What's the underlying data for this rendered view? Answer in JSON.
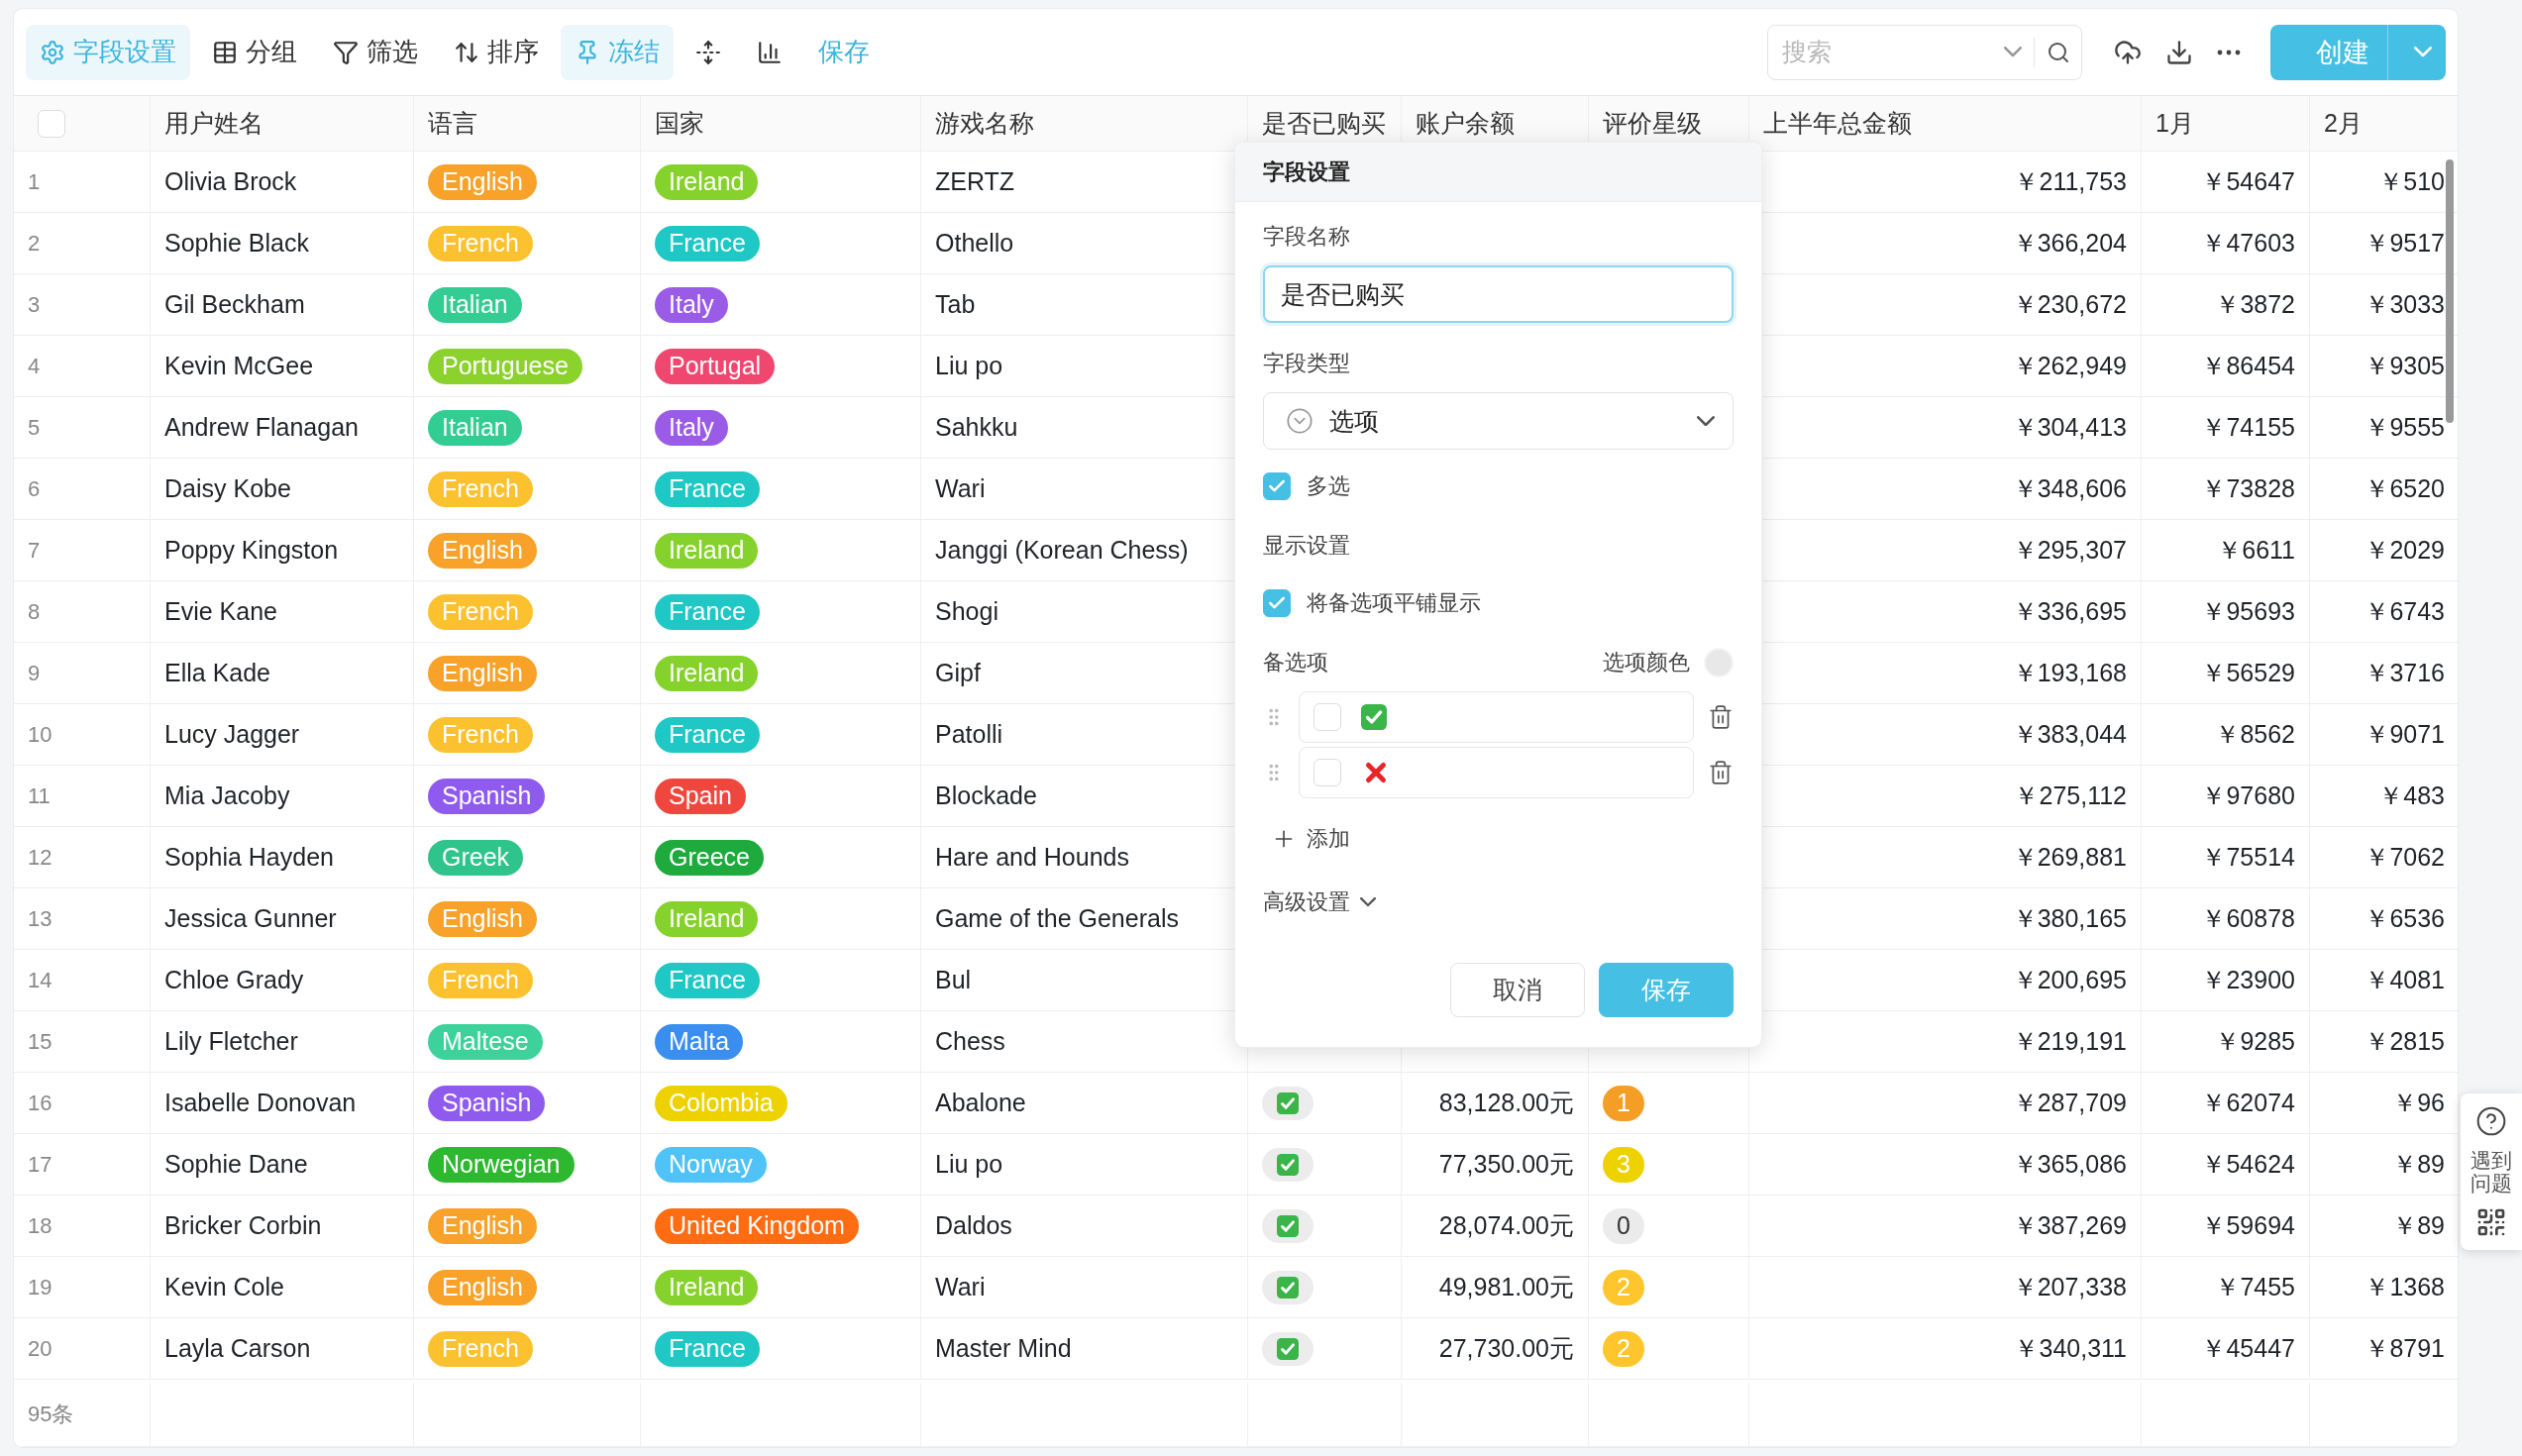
{
  "toolbar": {
    "buttons": [
      {
        "label": "字段设置",
        "selected": true
      },
      {
        "label": "分组",
        "selected": false
      },
      {
        "label": "筛选",
        "selected": false
      },
      {
        "label": "排序",
        "selected": false
      },
      {
        "label": "冻结",
        "selected": true
      },
      {
        "selected": false
      },
      {
        "selected": false
      }
    ],
    "save_link": "保存",
    "search": {
      "placeholder": "搜索"
    },
    "create_button": "创建"
  },
  "table": {
    "select_all": {
      "checked": false
    },
    "columns": [
      "用户姓名",
      "语言",
      "国家",
      "游戏名称",
      "是否已购买",
      "账户余额",
      "评价星级",
      "上半年总金额",
      "1月",
      "2月"
    ],
    "rows": [
      {
        "index": "1",
        "name": "Olivia Brock",
        "language": {
          "label": "English",
          "color": "#f8a229"
        },
        "country": {
          "label": "Ireland",
          "color": "#86d22c"
        },
        "game": "ZERTZ",
        "h1_total": "￥211,753",
        "jan": "￥54647",
        "feb": "￥510"
      },
      {
        "index": "2",
        "name": "Sophie Black",
        "language": {
          "label": "French",
          "color": "#fcc12f"
        },
        "country": {
          "label": "France",
          "color": "#1fc8c4"
        },
        "game": "Othello",
        "h1_total": "￥366,204",
        "jan": "￥47603",
        "feb": "￥9517"
      },
      {
        "index": "3",
        "name": "Gil Beckham",
        "language": {
          "label": "Italian",
          "color": "#33cc93"
        },
        "country": {
          "label": "Italy",
          "color": "#9a5ce6"
        },
        "game": "Tab",
        "h1_total": "￥230,672",
        "jan": "￥3872",
        "feb": "￥3033"
      },
      {
        "index": "4",
        "name": "Kevin McGee",
        "language": {
          "label": "Portuguese",
          "color": "#8bd22d"
        },
        "country": {
          "label": "Portugal",
          "color": "#ef4770"
        },
        "game": "Liu po",
        "h1_total": "￥262,949",
        "jan": "￥86454",
        "feb": "￥9305"
      },
      {
        "index": "5",
        "name": "Andrew Flanagan",
        "language": {
          "label": "Italian",
          "color": "#33cc93"
        },
        "country": {
          "label": "Italy",
          "color": "#9a5ce6"
        },
        "game": "Sahkku",
        "h1_total": "￥304,413",
        "jan": "￥74155",
        "feb": "￥9555"
      },
      {
        "index": "6",
        "name": "Daisy Kobe",
        "language": {
          "label": "French",
          "color": "#fcc12f"
        },
        "country": {
          "label": "France",
          "color": "#1fc8c4"
        },
        "game": "Wari",
        "h1_total": "￥348,606",
        "jan": "￥73828",
        "feb": "￥6520"
      },
      {
        "index": "7",
        "name": "Poppy Kingston",
        "language": {
          "label": "English",
          "color": "#f8a229"
        },
        "country": {
          "label": "Ireland",
          "color": "#86d22c"
        },
        "game": "Janggi (Korean Chess)",
        "h1_total": "￥295,307",
        "jan": "￥6611",
        "feb": "￥2029"
      },
      {
        "index": "8",
        "name": "Evie Kane",
        "language": {
          "label": "French",
          "color": "#fcc12f"
        },
        "country": {
          "label": "France",
          "color": "#1fc8c4"
        },
        "game": "Shogi",
        "h1_total": "￥336,695",
        "jan": "￥95693",
        "feb": "￥6743"
      },
      {
        "index": "9",
        "name": "Ella Kade",
        "language": {
          "label": "English",
          "color": "#f8a229"
        },
        "country": {
          "label": "Ireland",
          "color": "#86d22c"
        },
        "game": "Gipf",
        "h1_total": "￥193,168",
        "jan": "￥56529",
        "feb": "￥3716"
      },
      {
        "index": "10",
        "name": "Lucy Jagger",
        "language": {
          "label": "French",
          "color": "#fcc12f"
        },
        "country": {
          "label": "France",
          "color": "#1fc8c4"
        },
        "game": "Patolli",
        "h1_total": "￥383,044",
        "jan": "￥8562",
        "feb": "￥9071"
      },
      {
        "index": "11",
        "name": "Mia Jacoby",
        "language": {
          "label": "Spanish",
          "color": "#8f5bef"
        },
        "country": {
          "label": "Spain",
          "color": "#ef463d"
        },
        "game": "Blockade",
        "h1_total": "￥275,112",
        "jan": "￥97680",
        "feb": "￥483"
      },
      {
        "index": "12",
        "name": "Sophia Hayden",
        "language": {
          "label": "Greek",
          "color": "#2fc48c"
        },
        "country": {
          "label": "Greece",
          "color": "#1eaa3c"
        },
        "game": "Hare and Hounds",
        "h1_total": "￥269,881",
        "jan": "￥75514",
        "feb": "￥7062"
      },
      {
        "index": "13",
        "name": "Jessica Gunner",
        "language": {
          "label": "English",
          "color": "#f8a229"
        },
        "country": {
          "label": "Ireland",
          "color": "#86d22c"
        },
        "game": "Game of the Generals",
        "h1_total": "￥380,165",
        "jan": "￥60878",
        "feb": "￥6536"
      },
      {
        "index": "14",
        "name": "Chloe Grady",
        "language": {
          "label": "French",
          "color": "#fcc12f"
        },
        "country": {
          "label": "France",
          "color": "#1fc8c4"
        },
        "game": "Bul",
        "h1_total": "￥200,695",
        "jan": "￥23900",
        "feb": "￥4081"
      },
      {
        "index": "15",
        "name": "Lily Fletcher",
        "language": {
          "label": "Maltese",
          "color": "#3dd29c"
        },
        "country": {
          "label": "Malta",
          "color": "#3a8ef0"
        },
        "game": "Chess",
        "h1_total": "￥219,191",
        "jan": "￥9285",
        "feb": "￥2815"
      },
      {
        "index": "16",
        "name": "Isabelle Donovan",
        "language": {
          "label": "Spanish",
          "color": "#8f5bef"
        },
        "country": {
          "label": "Colombia",
          "color": "#eed200"
        },
        "game": "Abalone",
        "purchased": true,
        "balance": "83,128.00元",
        "rating": {
          "label": "1",
          "color": "#f59e26"
        },
        "h1_total": "￥287,709",
        "jan": "￥62074",
        "feb": "￥96"
      },
      {
        "index": "17",
        "name": "Sophie Dane",
        "language": {
          "label": "Norwegian",
          "color": "#2db82f"
        },
        "country": {
          "label": "Norway",
          "color": "#4fc3f7"
        },
        "game": "Liu po",
        "purchased": true,
        "balance": "77,350.00元",
        "rating": {
          "label": "3",
          "color": "#eed200"
        },
        "h1_total": "￥365,086",
        "jan": "￥54624",
        "feb": "￥89"
      },
      {
        "index": "18",
        "name": "Bricker Corbin",
        "language": {
          "label": "English",
          "color": "#f8a229"
        },
        "country": {
          "label": "United Kingdom",
          "color": "#ff6c12"
        },
        "game": "Daldos",
        "purchased": true,
        "balance": "28,074.00元",
        "rating": {
          "label": "0",
          "color": "#ebebeb"
        },
        "h1_total": "￥387,269",
        "jan": "￥59694",
        "feb": "￥89"
      },
      {
        "index": "19",
        "name": "Kevin Cole",
        "language": {
          "label": "English",
          "color": "#f8a229"
        },
        "country": {
          "label": "Ireland",
          "color": "#86d22c"
        },
        "game": "Wari",
        "purchased": true,
        "balance": "49,981.00元",
        "rating": {
          "label": "2",
          "color": "#fec62c"
        },
        "h1_total": "￥207,338",
        "jan": "￥7455",
        "feb": "￥1368"
      },
      {
        "index": "20",
        "name": "Layla Carson",
        "language": {
          "label": "French",
          "color": "#fcc12f"
        },
        "country": {
          "label": "France",
          "color": "#1fc8c4"
        },
        "game": "Master Mind",
        "purchased": true,
        "balance": "27,730.00元",
        "rating": {
          "label": "2",
          "color": "#fec62c"
        },
        "h1_total": "￥340,311",
        "jan": "￥45447",
        "feb": "￥8791"
      }
    ],
    "footer_count": "95条"
  },
  "field_settings": {
    "title": "字段设置",
    "name_label": "字段名称",
    "name_value": "是否已购买",
    "type_label": "字段类型",
    "type_value": "选项",
    "multi_select": {
      "label": "多选",
      "checked": true
    },
    "display_heading": "显示设置",
    "tile_display": {
      "label": "将备选项平铺显示",
      "checked": true
    },
    "options_heading": "备选项",
    "option_color_label": "选项颜色",
    "options": [
      {
        "kind": "check",
        "checked": false
      },
      {
        "kind": "cross",
        "checked": false
      }
    ],
    "add_label": "添加",
    "advanced_label": "高级设置",
    "cancel": "取消",
    "save": "保存"
  },
  "help_widget": {
    "label": "遇到问题"
  }
}
